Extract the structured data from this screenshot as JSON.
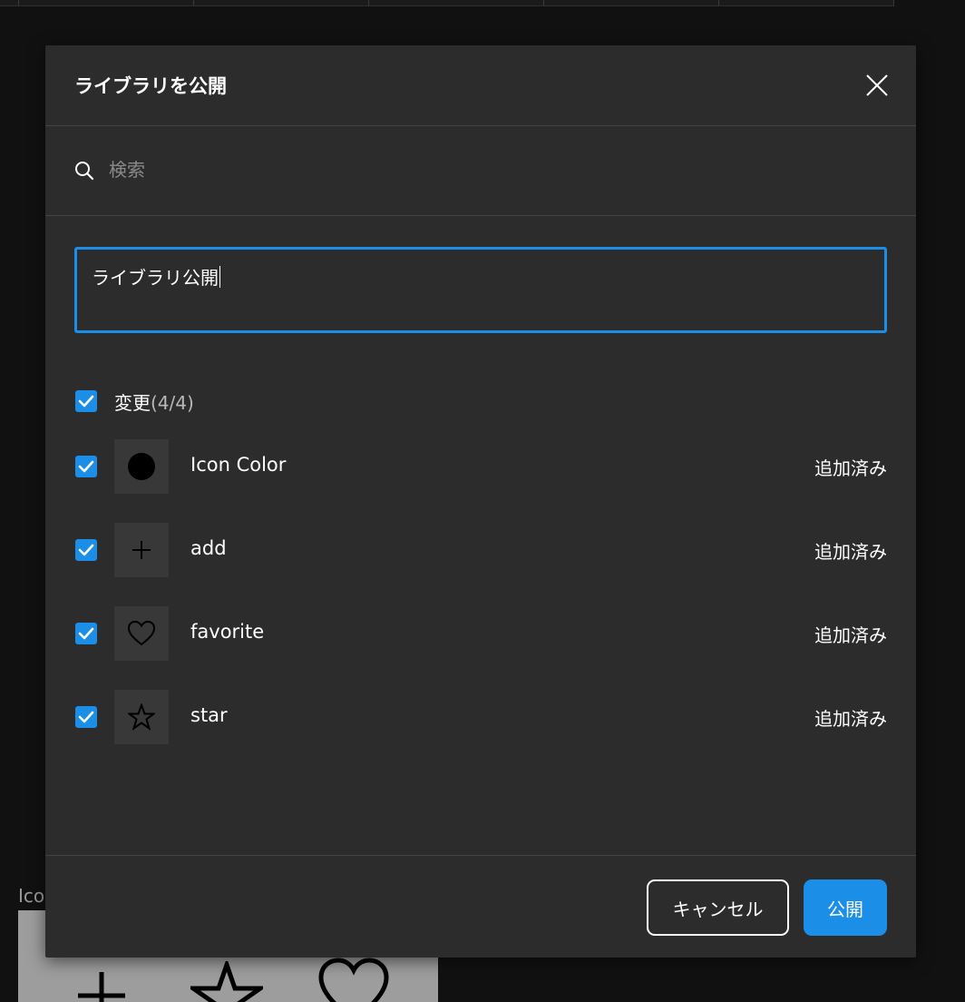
{
  "background": {
    "frame_label": "Ico"
  },
  "modal": {
    "title": "ライブラリを公開",
    "close_icon": "close-icon",
    "search": {
      "placeholder": "検索",
      "value": ""
    },
    "message": {
      "value": "ライブラリ公開"
    },
    "changes": {
      "label": "変更",
      "count": "(4/4)",
      "checked": true
    },
    "items": [
      {
        "name": "Icon Color",
        "status": "追加済み",
        "icon": "circle-fill-icon",
        "checked": true
      },
      {
        "name": "add",
        "status": "追加済み",
        "icon": "plus-icon",
        "checked": true
      },
      {
        "name": "favorite",
        "status": "追加済み",
        "icon": "heart-icon",
        "checked": true
      },
      {
        "name": "star",
        "status": "追加済み",
        "icon": "star-icon",
        "checked": true
      }
    ],
    "footer": {
      "cancel_label": "キャンセル",
      "publish_label": "公開"
    }
  },
  "colors": {
    "accent": "#1b8ee8",
    "modal_bg": "#2c2c2c",
    "page_bg": "#111111",
    "thumb_bg": "#383838"
  }
}
